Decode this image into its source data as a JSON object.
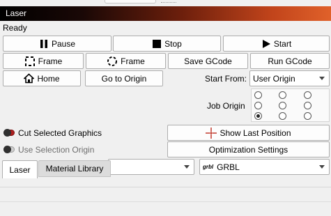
{
  "window": {
    "title": "Laser"
  },
  "status": {
    "text": "Ready"
  },
  "buttons": {
    "pause": "Pause",
    "stop": "Stop",
    "start": "Start",
    "frame_rect": "Frame",
    "frame_circle": "Frame",
    "save_gcode": "Save GCode",
    "run_gcode": "Run GCode",
    "home": "Home",
    "go_to_origin": "Go to Origin",
    "show_last_position": "Show Last Position",
    "optimization_settings": "Optimization Settings"
  },
  "start_from": {
    "label": "Start From:",
    "value": "User Origin"
  },
  "job_origin": {
    "label": "Job Origin",
    "selected": "bottom-left"
  },
  "options": {
    "cut_selected_graphics": {
      "label": "Cut Selected Graphics",
      "on": true,
      "color": "#b01e1e"
    },
    "use_selection_origin": {
      "label": "Use Selection Origin",
      "on": false
    }
  },
  "device": {
    "value": "GRBL",
    "icon_text": "grbl"
  },
  "tabs": [
    {
      "label": "Laser",
      "active": true
    },
    {
      "label": "Material Library",
      "active": false
    }
  ]
}
